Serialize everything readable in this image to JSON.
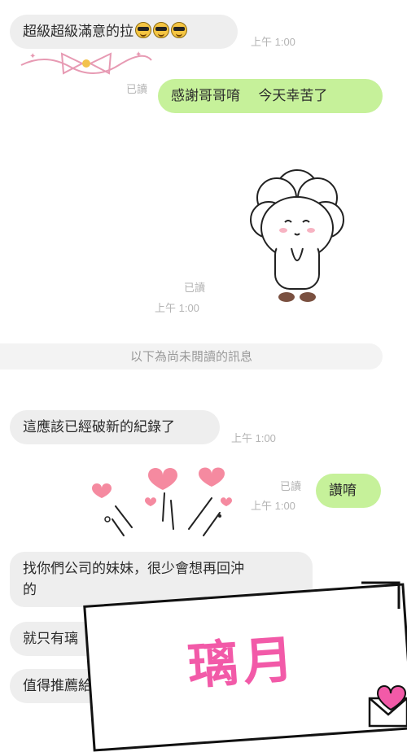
{
  "messages": {
    "m1": {
      "text": "超級超級滿意的拉",
      "time": "上午 1:00"
    },
    "m2": {
      "text": "感謝哥哥唷　 今天幸苦了",
      "read": "已讀"
    },
    "sticker": {
      "read": "已讀",
      "time": "上午 1:00"
    },
    "unread_divider": "以下為尚未閱讀的訊息",
    "m3": {
      "text": "這應該已經破新的紀錄了",
      "time": "上午 1:00"
    },
    "m4": {
      "text": "讚唷",
      "read": "已讀",
      "time": "上午 1:00"
    },
    "m5": {
      "line1": "找你們公司的妹妹，很少會想再回沖",
      "line2": "的"
    },
    "m6": {
      "text": "就只有璃"
    },
    "m7": {
      "text": "值得推薦給"
    }
  },
  "overlay": {
    "title": "璃月"
  },
  "colors": {
    "incoming": "#eeeeee",
    "outgoing": "#c6f19a",
    "accent": "#f25aa8"
  },
  "icons": [
    "sunglasses-emoji-icon",
    "ribbon-bow-icon",
    "bowing-sheep-sticker",
    "hearts-burst-icon",
    "heart-envelope-icon"
  ]
}
